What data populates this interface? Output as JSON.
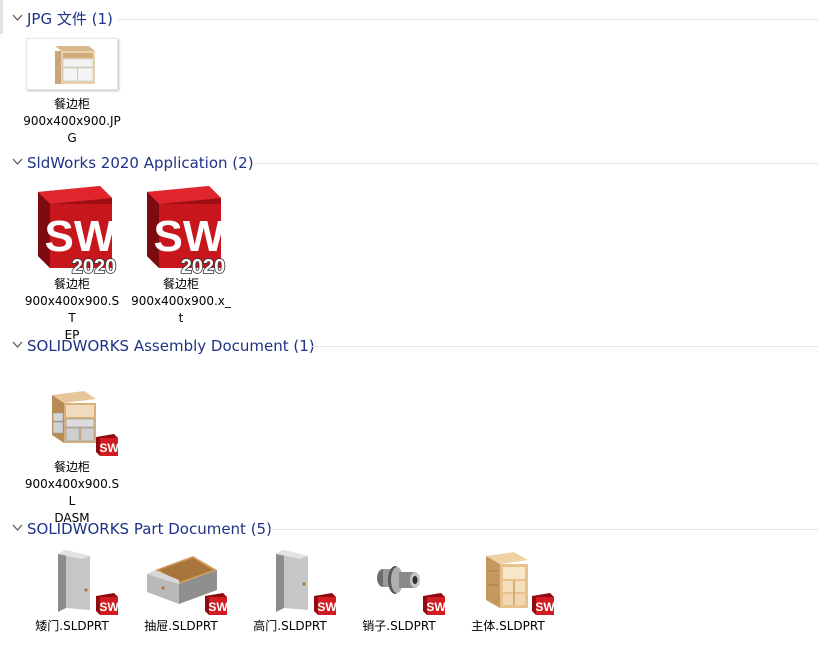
{
  "groups": [
    {
      "title": "JPG 文件 (1)",
      "items": [
        {
          "line1": "餐边柜",
          "line2": "900x400x900.JP",
          "line3": "G",
          "icon": "image-thumbnail-icon"
        }
      ]
    },
    {
      "title": "SldWorks 2020 Application (2)",
      "items": [
        {
          "line1": "餐边柜",
          "line2": "900x400x900.ST",
          "line3": "EP",
          "icon": "solidworks-2020-icon"
        },
        {
          "line1": "餐边柜",
          "line2": "900x400x900.x_",
          "line3": "t",
          "icon": "solidworks-2020-icon"
        }
      ]
    },
    {
      "title": "SOLIDWORKS Assembly Document (1)",
      "items": [
        {
          "line1": "餐边柜",
          "line2": "900x400x900.SL",
          "line3": "DASM",
          "icon": "assembly-cabinet-icon"
        }
      ]
    },
    {
      "title": "SOLIDWORKS Part Document (5)",
      "items": [
        {
          "line1": "矮门.SLDPRT",
          "icon": "door-part-icon"
        },
        {
          "line1": "抽屉.SLDPRT",
          "icon": "drawer-part-icon"
        },
        {
          "line1": "高门.SLDPRT",
          "icon": "door-part-icon"
        },
        {
          "line1": "销子.SLDPRT",
          "icon": "pin-part-icon"
        },
        {
          "line1": "主体.SLDPRT",
          "icon": "frame-part-icon"
        }
      ]
    }
  ],
  "badge": {
    "sw_text": "SW",
    "version_text": "2020"
  },
  "colors": {
    "header": "#1e3287",
    "sw_red": "#c8161d",
    "divider": "#e5e5e5"
  }
}
